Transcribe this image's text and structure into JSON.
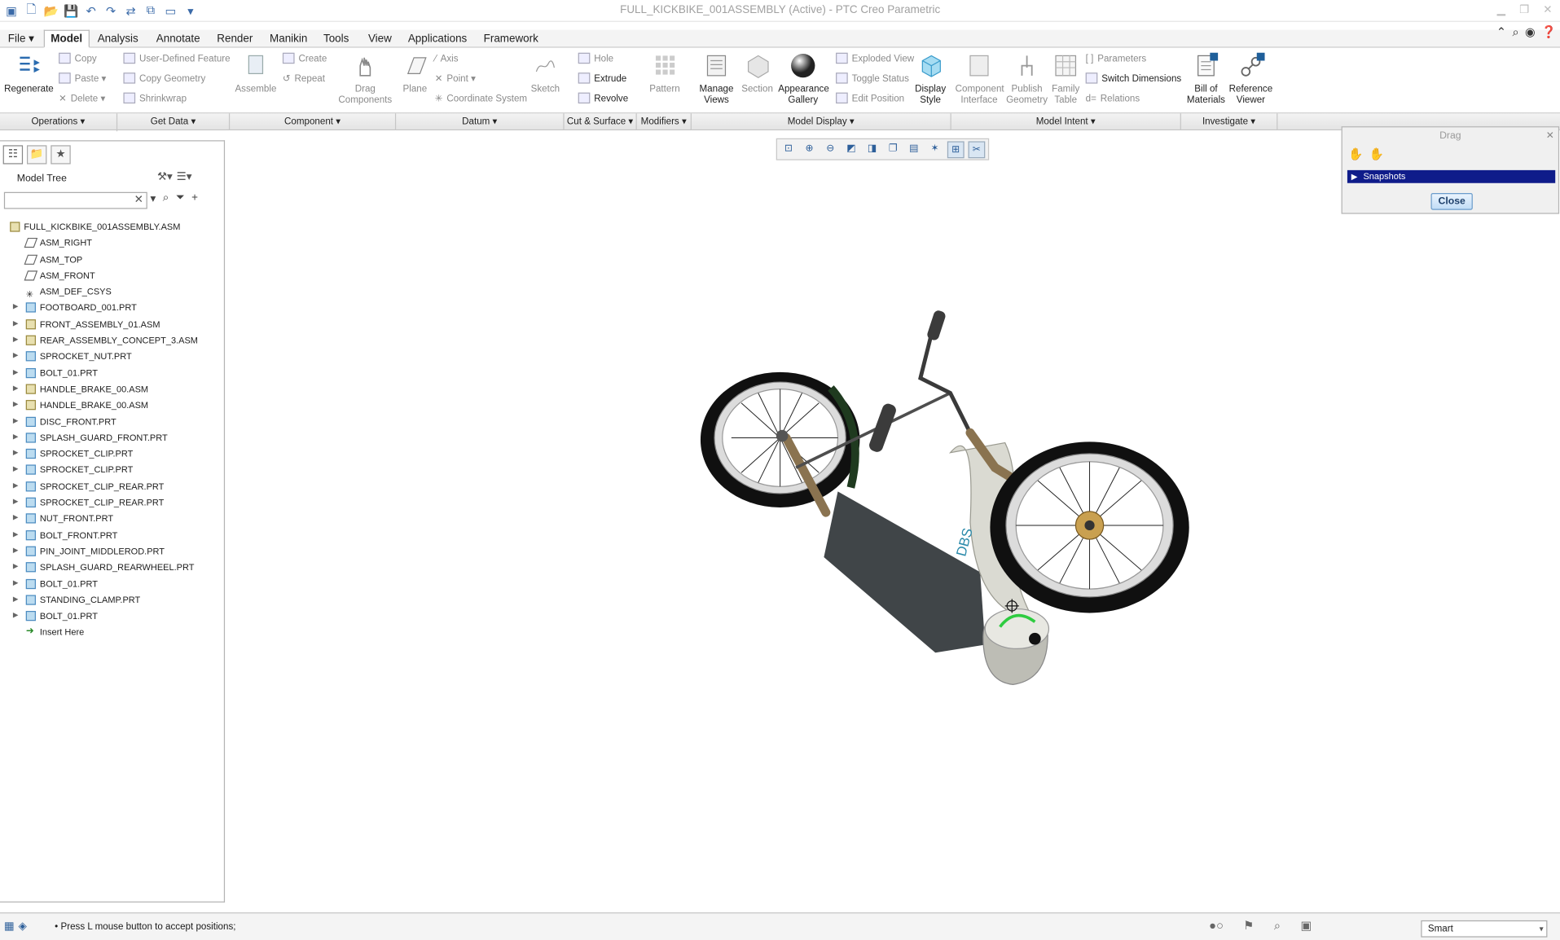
{
  "window": {
    "title": "FULL_KICKBIKE_001ASSEMBLY (Active) - PTC Creo Parametric"
  },
  "tabs": [
    {
      "label": "File ▾"
    },
    {
      "label": "Model"
    },
    {
      "label": "Analysis"
    },
    {
      "label": "Annotate"
    },
    {
      "label": "Render"
    },
    {
      "label": "Manikin"
    },
    {
      "label": "Tools"
    },
    {
      "label": "View"
    },
    {
      "label": "Applications"
    },
    {
      "label": "Framework"
    }
  ],
  "ribbon": {
    "regenerate": "Regenerate",
    "copy": "Copy",
    "paste": "Paste",
    "delete": "Delete",
    "udf": "User-Defined Feature",
    "copy_geometry": "Copy Geometry",
    "shrinkwrap": "Shrinkwrap",
    "assemble": "Assemble",
    "create": "Create",
    "repeat": "Repeat",
    "drag_components": "Drag Components",
    "plane": "Plane",
    "axis": "Axis",
    "point": "Point",
    "coordinate_system": "Coordinate System",
    "sketch": "Sketch",
    "hole": "Hole",
    "extrude": "Extrude",
    "revolve": "Revolve",
    "pattern": "Pattern",
    "manage_views": "Manage Views",
    "section": "Section",
    "appearance_gallery": "Appearance Gallery",
    "exploded_view": "Exploded View",
    "toggle_status": "Toggle Status",
    "edit_position": "Edit Position",
    "display_style": "Display Style",
    "component_interface": "Component Interface",
    "publish_geometry": "Publish Geometry",
    "family_table": "Family Table",
    "parameters": "Parameters",
    "switch_dimensions": "Switch Dimensions",
    "relations": "Relations",
    "bill_of_materials": "Bill of Materials",
    "reference_viewer": "Reference Viewer"
  },
  "groups": [
    {
      "label": "Operations ▾",
      "w": 118
    },
    {
      "label": "Get Data ▾",
      "w": 113
    },
    {
      "label": "Component ▾",
      "w": 167
    },
    {
      "label": "Datum ▾",
      "w": 169
    },
    {
      "label": "Cut & Surface ▾",
      "w": 73
    },
    {
      "label": "Modifiers ▾",
      "w": 55
    },
    {
      "label": "Model Display ▾",
      "w": 261
    },
    {
      "label": "Model Intent ▾",
      "w": 231
    },
    {
      "label": "Investigate ▾",
      "w": 97
    }
  ],
  "model_tree": {
    "title": "Model Tree",
    "search": {
      "value": "",
      "placeholder": ""
    },
    "items": [
      {
        "label": "FULL_KICKBIKE_001ASSEMBLY.ASM",
        "type": "asm",
        "indent": 0,
        "arrow": false
      },
      {
        "label": "ASM_RIGHT",
        "type": "plane",
        "indent": 1,
        "arrow": false
      },
      {
        "label": "ASM_TOP",
        "type": "plane",
        "indent": 1,
        "arrow": false
      },
      {
        "label": "ASM_FRONT",
        "type": "plane",
        "indent": 1,
        "arrow": false
      },
      {
        "label": "ASM_DEF_CSYS",
        "type": "csys",
        "indent": 1,
        "arrow": false
      },
      {
        "label": "FOOTBOARD_001.PRT",
        "type": "part",
        "indent": 1,
        "arrow": true
      },
      {
        "label": "FRONT_ASSEMBLY_01.ASM",
        "type": "asm",
        "indent": 1,
        "arrow": true
      },
      {
        "label": "REAR_ASSEMBLY_CONCEPT_3.ASM",
        "type": "asm",
        "indent": 1,
        "arrow": true
      },
      {
        "label": "SPROCKET_NUT.PRT",
        "type": "part",
        "indent": 1,
        "arrow": true
      },
      {
        "label": "BOLT_01.PRT",
        "type": "part",
        "indent": 1,
        "arrow": true
      },
      {
        "label": "HANDLE_BRAKE_00.ASM",
        "type": "asm",
        "indent": 1,
        "arrow": true
      },
      {
        "label": "HANDLE_BRAKE_00.ASM",
        "type": "asm",
        "indent": 1,
        "arrow": true
      },
      {
        "label": "DISC_FRONT.PRT",
        "type": "part",
        "indent": 1,
        "arrow": true
      },
      {
        "label": "SPLASH_GUARD_FRONT.PRT",
        "type": "part",
        "indent": 1,
        "arrow": true
      },
      {
        "label": "SPROCKET_CLIP.PRT",
        "type": "part",
        "indent": 1,
        "arrow": true
      },
      {
        "label": "SPROCKET_CLIP.PRT",
        "type": "part",
        "indent": 1,
        "arrow": true
      },
      {
        "label": "SPROCKET_CLIP_REAR.PRT",
        "type": "part",
        "indent": 1,
        "arrow": true
      },
      {
        "label": "SPROCKET_CLIP_REAR.PRT",
        "type": "part",
        "indent": 1,
        "arrow": true
      },
      {
        "label": "NUT_FRONT.PRT",
        "type": "part",
        "indent": 1,
        "arrow": true
      },
      {
        "label": "BOLT_FRONT.PRT",
        "type": "part",
        "indent": 1,
        "arrow": true
      },
      {
        "label": "PIN_JOINT_MIDDLEROD.PRT",
        "type": "part",
        "indent": 1,
        "arrow": true
      },
      {
        "label": "SPLASH_GUARD_REARWHEEL.PRT",
        "type": "part",
        "indent": 1,
        "arrow": true
      },
      {
        "label": "BOLT_01.PRT",
        "type": "part",
        "indent": 1,
        "arrow": true
      },
      {
        "label": "STANDING_CLAMP.PRT",
        "type": "part",
        "indent": 1,
        "arrow": true
      },
      {
        "label": "BOLT_01.PRT",
        "type": "part",
        "indent": 1,
        "arrow": true
      },
      {
        "label": "Insert Here",
        "type": "ins",
        "indent": 1,
        "arrow": false
      }
    ]
  },
  "drag_dialog": {
    "title": "Drag",
    "snapshots": "Snapshots",
    "close": "Close"
  },
  "status": {
    "message": "Press L mouse button to accept positions;",
    "filter": "Smart"
  },
  "model_label": "DBS"
}
